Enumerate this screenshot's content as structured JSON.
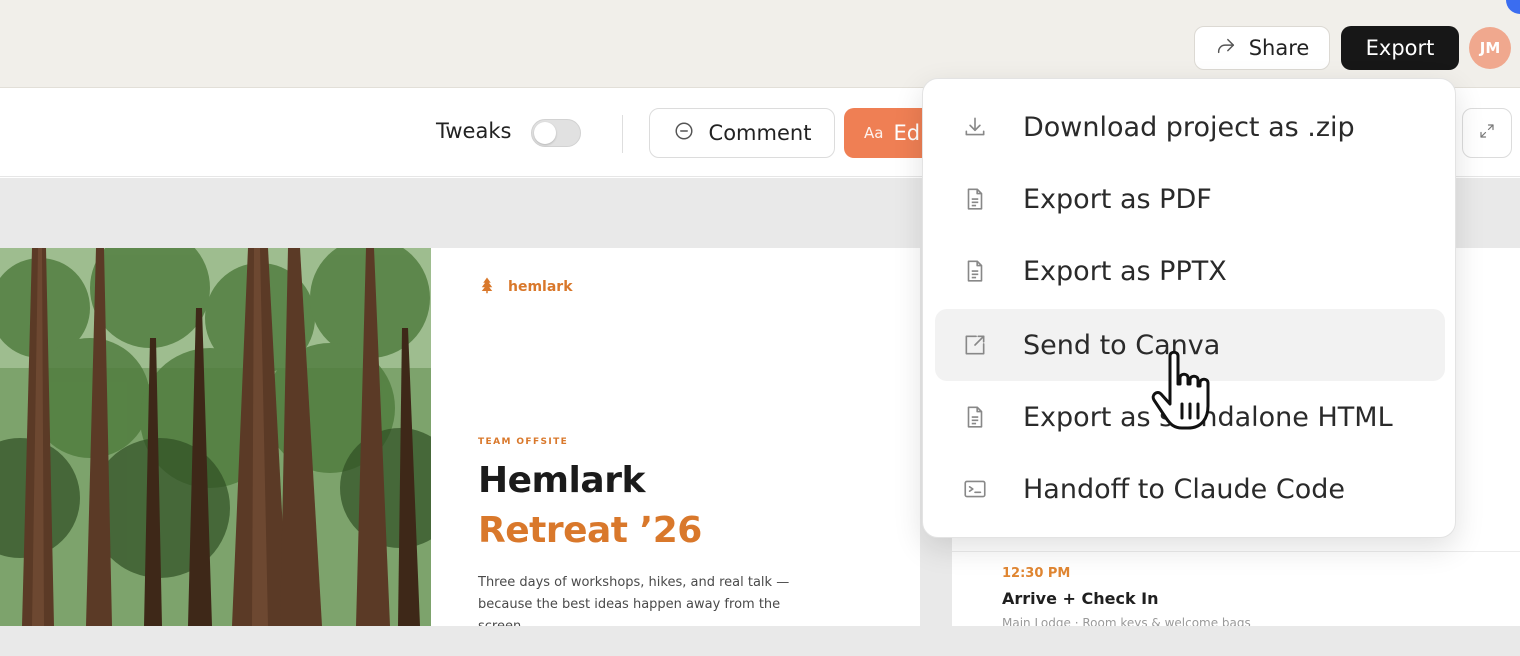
{
  "topbar": {
    "share_label": "Share",
    "export_label": "Export",
    "avatar_initials": "JM"
  },
  "toolbar": {
    "tweaks_label": "Tweaks",
    "tweaks_on": false,
    "comment_label": "Comment",
    "edit_icon_text": "Aa",
    "edit_label": "Ed"
  },
  "slide": {
    "brand": "hemlark",
    "eyebrow": "TEAM OFFSITE",
    "title_line1": "Hemlark",
    "title_line2": "Retreat ’26",
    "description": "Three days of workshops, hikes, and real talk — because the best ideas happen away from the screen."
  },
  "schedule": {
    "time": "12:30 PM",
    "title": "Arrive + Check In",
    "subtitle": "Main Lodge · Room keys & welcome bags"
  },
  "export_menu": {
    "items": [
      {
        "label": "Download project as .zip",
        "icon": "download-icon"
      },
      {
        "label": "Export as PDF",
        "icon": "document-icon"
      },
      {
        "label": "Export as PPTX",
        "icon": "document-icon"
      },
      {
        "label": "Send to Canva",
        "icon": "external-link-icon",
        "hovered": true
      },
      {
        "label": "Export as standalone HTML",
        "icon": "document-icon"
      },
      {
        "label": "Handoff to Claude Code",
        "icon": "terminal-icon"
      }
    ]
  },
  "colors": {
    "accent_orange": "#d9782b",
    "edit_button": "#ef7f54",
    "export_button": "#171717",
    "avatar": "#f0a88e"
  }
}
